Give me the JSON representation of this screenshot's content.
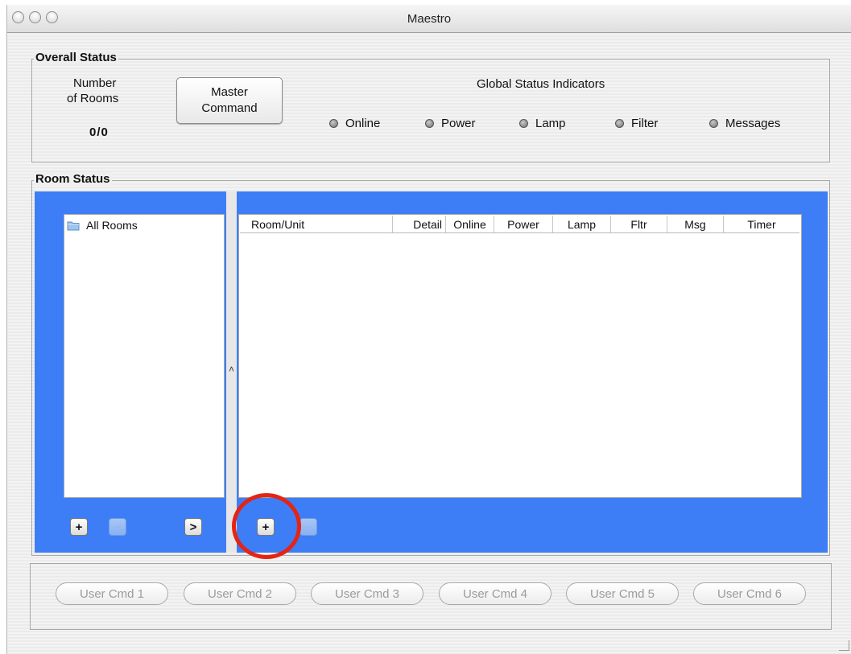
{
  "window": {
    "title": "Maestro"
  },
  "overall_status": {
    "group_label": "Overall Status",
    "rooms_label_line1": "Number",
    "rooms_label_line2": "of Rooms",
    "rooms_value": "0/0",
    "master_btn_line1": "Master",
    "master_btn_line2": "Command",
    "global_label": "Global Status Indicators",
    "indicators": [
      "Online",
      "Power",
      "Lamp",
      "Filter",
      "Messages"
    ]
  },
  "room_status": {
    "group_label": "Room Status",
    "tree_root": "All Rooms",
    "columns": [
      "Room/Unit",
      "Detail",
      "Online",
      "Power",
      "Lamp",
      "Fltr",
      "Msg",
      "Timer"
    ]
  },
  "user_cmds": [
    "User Cmd 1",
    "User Cmd 2",
    "User Cmd 3",
    "User Cmd 4",
    "User Cmd 5",
    "User Cmd 6"
  ],
  "colors": {
    "panel_blue": "#3d7ef6",
    "highlight": "#e42414"
  }
}
